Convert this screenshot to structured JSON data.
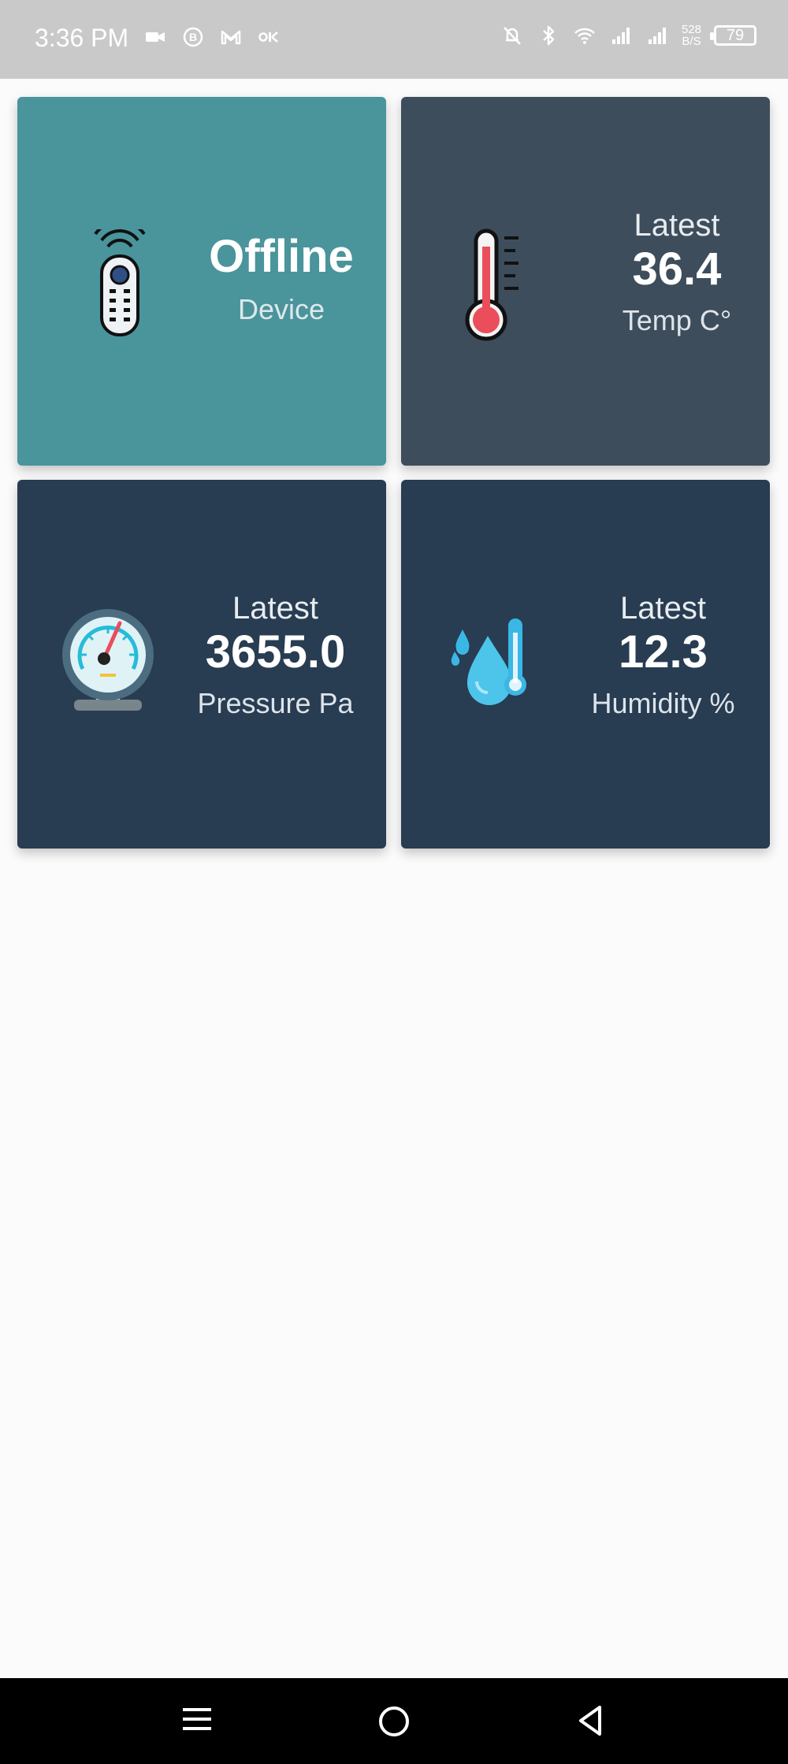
{
  "status_bar": {
    "time": "3:36 PM",
    "net_speed_value": "528",
    "net_speed_unit": "B/S",
    "battery": "79",
    "left_icons": [
      "video-camera-icon",
      "b-badge-icon",
      "gmail-icon",
      "voicemail-icon"
    ],
    "right_icons": [
      "muted-bell-icon",
      "bluetooth-icon",
      "wifi-icon",
      "signal-icon",
      "signal-icon"
    ]
  },
  "cards": {
    "device": {
      "icon": "remote-control-icon",
      "status": "Offline",
      "label": "Device",
      "color": "#4a949c"
    },
    "temperature": {
      "icon": "thermometer-icon",
      "heading": "Latest",
      "value": "36.4",
      "unit": "Temp C°",
      "color": "#3d4d5c"
    },
    "pressure": {
      "icon": "pressure-gauge-icon",
      "heading": "Latest",
      "value": "3655.0",
      "unit": "Pressure Pa",
      "color": "#283c52"
    },
    "humidity": {
      "icon": "humidity-drop-icon",
      "heading": "Latest",
      "value": "12.3",
      "unit": "Humidity %",
      "color": "#283c52"
    }
  },
  "nav_bar": {
    "buttons": [
      "menu-icon",
      "home-icon",
      "back-icon"
    ]
  }
}
